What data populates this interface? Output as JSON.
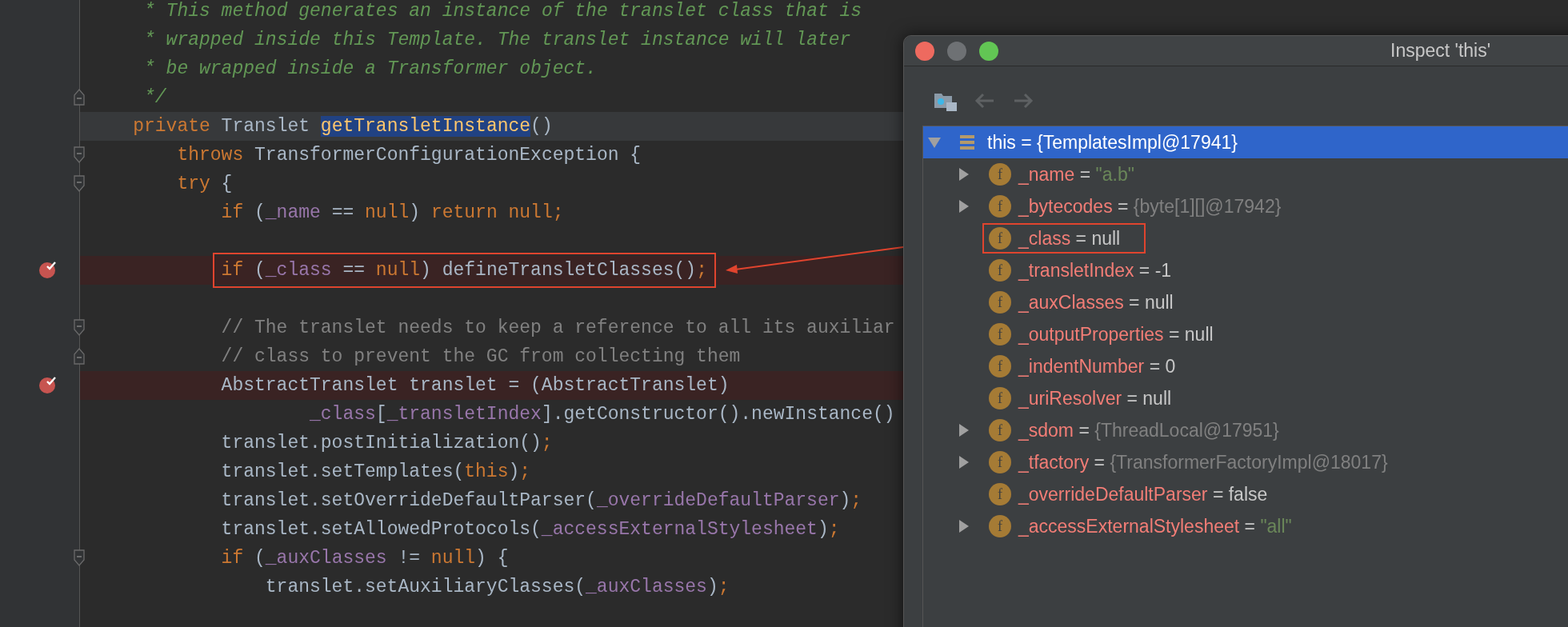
{
  "editor": {
    "lines": [
      {
        "tokens": [
          {
            "kind": "doc_comment",
            "text": "     * This method generates an instance of the translet class that is"
          }
        ],
        "breakpoint": false,
        "boxed": false,
        "current": false
      },
      {
        "tokens": [
          {
            "kind": "doc_comment",
            "text": "     * wrapped inside this Template. The translet instance will later"
          }
        ],
        "breakpoint": false,
        "boxed": false,
        "current": false
      },
      {
        "tokens": [
          {
            "kind": "doc_comment",
            "text": "     * be wrapped inside a Transformer object."
          }
        ],
        "breakpoint": false,
        "boxed": false,
        "current": false
      },
      {
        "tokens": [
          {
            "kind": "doc_comment",
            "text": "     */"
          }
        ],
        "breakpoint": false,
        "boxed": false,
        "current": false,
        "fold": {
          "kind": "end"
        }
      },
      {
        "tokens": [
          {
            "kind": "keyword",
            "text": "    private"
          },
          {
            "kind": "plain",
            "text": " Translet "
          },
          {
            "kind": "declaration",
            "text": "getTransletInstance"
          },
          {
            "kind": "plain",
            "text": "()"
          }
        ],
        "breakpoint": false,
        "boxed": false,
        "current": true
      },
      {
        "tokens": [
          {
            "kind": "keyword",
            "text": "        throws"
          },
          {
            "kind": "plain",
            "text": " TransformerConfigurationException {"
          }
        ],
        "breakpoint": false,
        "boxed": false,
        "current": false,
        "fold": {
          "kind": "start"
        }
      },
      {
        "tokens": [
          {
            "kind": "keyword",
            "text": "        try"
          },
          {
            "kind": "plain",
            "text": " {"
          }
        ],
        "breakpoint": false,
        "boxed": false,
        "current": false,
        "fold": {
          "kind": "start"
        }
      },
      {
        "tokens": [
          {
            "kind": "keyword",
            "text": "            if"
          },
          {
            "kind": "plain",
            "text": " ("
          },
          {
            "kind": "field",
            "text": "_name"
          },
          {
            "kind": "plain",
            "text": " == "
          },
          {
            "kind": "keyword",
            "text": "null"
          },
          {
            "kind": "plain",
            "text": ") "
          },
          {
            "kind": "keyword",
            "text": "return null;"
          }
        ],
        "breakpoint": false,
        "boxed": false,
        "current": false
      },
      {
        "breakpoint": false,
        "current": false
      },
      {
        "tokens": [
          {
            "kind": "keyword",
            "text": "            if"
          },
          {
            "kind": "plain",
            "text": " ("
          },
          {
            "kind": "field",
            "text": "_class"
          },
          {
            "kind": "plain",
            "text": " == "
          },
          {
            "kind": "keyword",
            "text": "null"
          },
          {
            "kind": "plain",
            "text": ") defineTransletClasses()"
          },
          {
            "kind": "keyword",
            "text": ";"
          }
        ],
        "breakpoint": true,
        "boxed": true,
        "current": false
      },
      {
        "breakpoint": false,
        "current": false
      },
      {
        "tokens": [
          {
            "kind": "comment",
            "text": "            // The translet needs to keep a reference to all its auxiliar"
          }
        ],
        "breakpoint": false,
        "boxed": false,
        "current": false,
        "fold": {
          "kind": "start"
        }
      },
      {
        "tokens": [
          {
            "kind": "comment",
            "text": "            // class to prevent the GC from collecting them"
          }
        ],
        "breakpoint": false,
        "boxed": false,
        "current": false,
        "fold": {
          "kind": "end"
        }
      },
      {
        "tokens": [
          {
            "kind": "plain",
            "text": "            AbstractTranslet translet = (AbstractTranslet)"
          }
        ],
        "breakpoint": true,
        "boxed": false,
        "current": false
      },
      {
        "tokens": [
          {
            "kind": "field",
            "text": "                    _class"
          },
          {
            "kind": "plain",
            "text": "["
          },
          {
            "kind": "field",
            "text": "_transletIndex"
          },
          {
            "kind": "plain",
            "text": "].getConstructor().newInstance()"
          }
        ],
        "breakpoint": false,
        "boxed": false,
        "current": false
      },
      {
        "tokens": [
          {
            "kind": "plain",
            "text": "            translet.postInitialization()"
          },
          {
            "kind": "keyword",
            "text": ";"
          }
        ],
        "breakpoint": false,
        "boxed": false,
        "current": false
      },
      {
        "tokens": [
          {
            "kind": "plain",
            "text": "            translet.setTemplates("
          },
          {
            "kind": "keyword",
            "text": "this"
          },
          {
            "kind": "plain",
            "text": ")"
          },
          {
            "kind": "keyword",
            "text": ";"
          }
        ],
        "breakpoint": false,
        "boxed": false,
        "current": false
      },
      {
        "tokens": [
          {
            "kind": "plain",
            "text": "            translet.setOverrideDefaultParser("
          },
          {
            "kind": "field",
            "text": "_overrideDefaultParser"
          },
          {
            "kind": "plain",
            "text": ")"
          },
          {
            "kind": "keyword",
            "text": ";"
          }
        ],
        "breakpoint": false,
        "boxed": false,
        "current": false
      },
      {
        "tokens": [
          {
            "kind": "plain",
            "text": "            translet.setAllowedProtocols("
          },
          {
            "kind": "field",
            "text": "_accessExternalStylesheet"
          },
          {
            "kind": "plain",
            "text": ")"
          },
          {
            "kind": "keyword",
            "text": ";"
          }
        ],
        "breakpoint": false,
        "boxed": false,
        "current": false
      },
      {
        "tokens": [
          {
            "kind": "keyword",
            "text": "            if"
          },
          {
            "kind": "plain",
            "text": " ("
          },
          {
            "kind": "field",
            "text": "_auxClasses"
          },
          {
            "kind": "plain",
            "text": " != "
          },
          {
            "kind": "keyword",
            "text": "null"
          },
          {
            "kind": "plain",
            "text": ") {"
          }
        ],
        "breakpoint": false,
        "boxed": false,
        "current": false,
        "fold": {
          "kind": "start"
        }
      },
      {
        "tokens": [
          {
            "kind": "plain",
            "text": "                translet.setAuxiliaryClasses("
          },
          {
            "kind": "field",
            "text": "_auxClasses"
          },
          {
            "kind": "plain",
            "text": ")"
          },
          {
            "kind": "keyword",
            "text": ";"
          }
        ],
        "breakpoint": false,
        "boxed": false,
        "current": false
      }
    ]
  },
  "inspector": {
    "title": "Inspect 'this'",
    "back": {
      "disabled": true
    },
    "forward": {
      "disabled": true
    },
    "root": {
      "name": "this",
      "operator": "=",
      "value": "{TemplatesImpl@17941}",
      "expanded": true,
      "selected": true,
      "children": [
        {
          "badge": "f",
          "name": "_name",
          "operator": "=",
          "value": {
            "kind": "string",
            "text": "\"a.b\""
          },
          "expandable": true,
          "expanded": false,
          "boxed": false
        },
        {
          "badge": "f",
          "name": "_bytecodes",
          "operator": "=",
          "value": {
            "kind": "object",
            "text": "{byte[1][]@17942}"
          },
          "expandable": true,
          "expanded": false,
          "boxed": false
        },
        {
          "badge": "f",
          "name": "_class",
          "operator": "=",
          "value": {
            "kind": "primitive",
            "text": "null"
          },
          "expandable": false,
          "boxed": true
        },
        {
          "badge": "f",
          "name": "_transletIndex",
          "operator": "=",
          "value": {
            "kind": "primitive",
            "text": "-1"
          },
          "expandable": false,
          "boxed": false
        },
        {
          "badge": "f",
          "name": "_auxClasses",
          "operator": "=",
          "value": {
            "kind": "primitive",
            "text": "null"
          },
          "expandable": false,
          "boxed": false
        },
        {
          "badge": "f",
          "name": "_outputProperties",
          "operator": "=",
          "value": {
            "kind": "primitive",
            "text": "null"
          },
          "expandable": false,
          "boxed": false
        },
        {
          "badge": "f",
          "name": "_indentNumber",
          "operator": "=",
          "value": {
            "kind": "primitive",
            "text": "0"
          },
          "expandable": false,
          "boxed": false
        },
        {
          "badge": "f",
          "name": "_uriResolver",
          "operator": "=",
          "value": {
            "kind": "primitive",
            "text": "null"
          },
          "expandable": false,
          "boxed": false
        },
        {
          "badge": "f",
          "name": "_sdom",
          "operator": "=",
          "value": {
            "kind": "object",
            "text": "{ThreadLocal@17951}"
          },
          "expandable": true,
          "expanded": false,
          "boxed": false
        },
        {
          "badge": "f",
          "name": "_tfactory",
          "operator": "=",
          "value": {
            "kind": "object",
            "text": "{TransformerFactoryImpl@18017}"
          },
          "expandable": true,
          "expanded": false,
          "boxed": false
        },
        {
          "badge": "f",
          "name": "_overrideDefaultParser",
          "operator": "=",
          "value": {
            "kind": "primitive",
            "text": "false"
          },
          "expandable": false,
          "boxed": false
        },
        {
          "badge": "f",
          "name": "_accessExternalStylesheet",
          "operator": "=",
          "value": {
            "kind": "string",
            "text": "\"all\""
          },
          "expandable": true,
          "expanded": false,
          "boxed": false
        }
      ]
    }
  }
}
